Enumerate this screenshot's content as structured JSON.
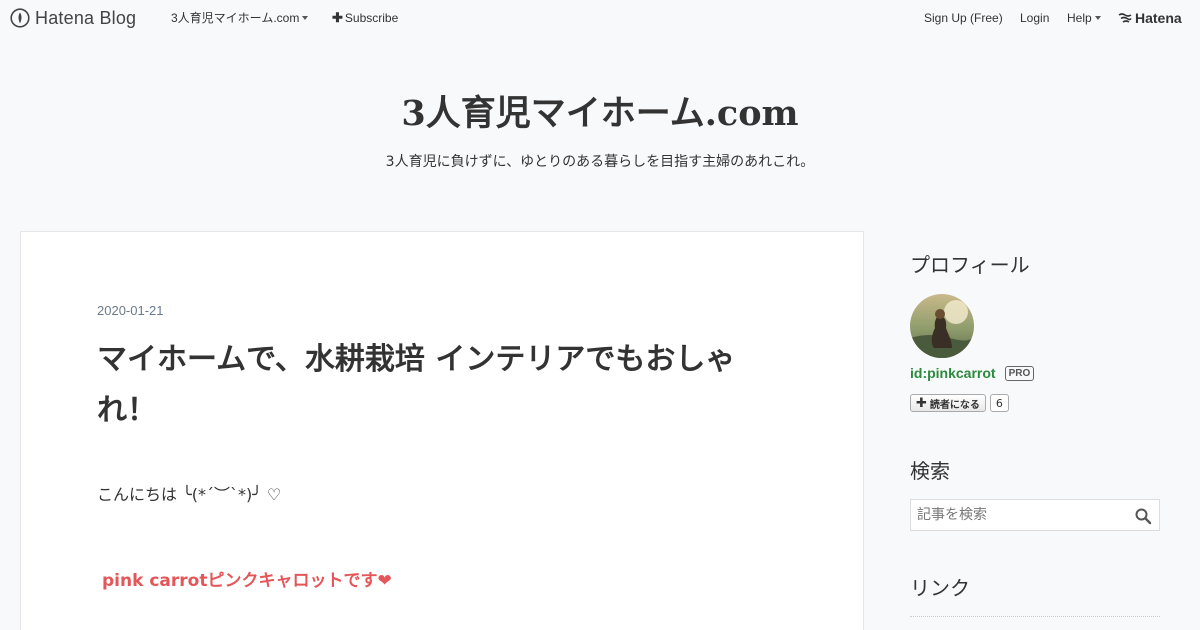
{
  "topbar": {
    "brand": "Hatena Blog",
    "blog_menu": "3人育児マイホーム.com",
    "subscribe": "Subscribe",
    "signup": "Sign Up (Free)",
    "login": "Login",
    "help": "Help",
    "hatena": "Hatena"
  },
  "header": {
    "title": "3人育児マイホーム.com",
    "description": "3人育児に負けずに、ゆとりのある暮らしを目指す主婦のあれこれ。"
  },
  "entry": {
    "date": "2020-01-21",
    "title": "マイホームで、水耕栽培 インテリアでもおしゃれ！",
    "greeting": "こんにちは ╰(*´︶`*)╯ ♡",
    "intro": "pink carrotピンクキャロットです❤"
  },
  "sidebar": {
    "profile_heading": "プロフィール",
    "user_id": "id:pinkcarrot",
    "pro_badge": "PRO",
    "subscribe_label": "読者になる",
    "subscriber_count": "6",
    "search_heading": "検索",
    "search_placeholder": "記事を検索",
    "links_heading": "リンク"
  },
  "colors": {
    "user_link": "#2a8b3e",
    "intro_text": "#e45659",
    "date_text": "#6a7a8a"
  }
}
